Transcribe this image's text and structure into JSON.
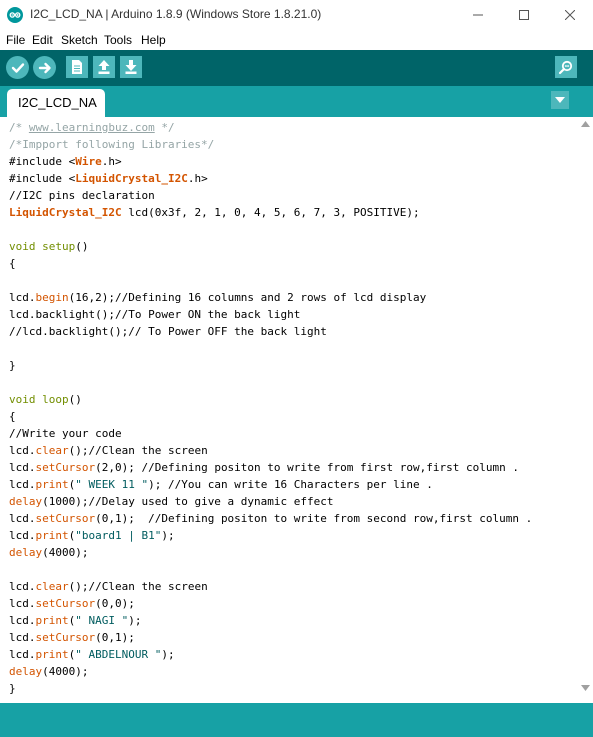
{
  "window": {
    "title": "I2C_LCD_NA | Arduino 1.8.9 (Windows Store 1.8.21.0)"
  },
  "menu": {
    "file": "File",
    "edit": "Edit",
    "sketch": "Sketch",
    "tools": "Tools",
    "help": "Help"
  },
  "toolbar": {
    "icons": [
      "verify-icon",
      "upload-icon",
      "new-icon",
      "open-icon",
      "save-icon",
      "serial-monitor-icon"
    ]
  },
  "tabs": [
    {
      "label": "I2C_LCD_NA",
      "active": true
    }
  ],
  "colors": {
    "toolbar_bg": "#006468",
    "tabstrip_bg": "#17a1a5",
    "button_bg": "#4db7bb",
    "comment": "#95a5a6",
    "keyword": "#728e00",
    "function": "#d35400",
    "string": "#005c5f"
  },
  "code": [
    [
      {
        "t": "/* ",
        "c": "com"
      },
      {
        "t": "www.learningbuz.com",
        "c": "url"
      },
      {
        "t": " */",
        "c": "com"
      }
    ],
    [
      {
        "t": "/*Impport following Libraries*/",
        "c": "com"
      }
    ],
    [
      {
        "t": "#include <",
        "c": "plain"
      },
      {
        "t": "Wire",
        "c": "cls"
      },
      {
        "t": ".h>",
        "c": "plain"
      }
    ],
    [
      {
        "t": "#include <",
        "c": "plain"
      },
      {
        "t": "LiquidCrystal_I2C",
        "c": "cls"
      },
      {
        "t": ".h>",
        "c": "plain"
      }
    ],
    [
      {
        "t": "//I2C pins declaration",
        "c": "plain"
      }
    ],
    [
      {
        "t": "LiquidCrystal_I2C",
        "c": "cls"
      },
      {
        "t": " lcd(0x3f, 2, 1, 0, 4, 5, 6, 7, 3, POSITIVE);",
        "c": "plain"
      }
    ],
    [],
    [
      {
        "t": "void",
        "c": "kw"
      },
      {
        "t": " ",
        "c": "plain"
      },
      {
        "t": "setup",
        "c": "kw"
      },
      {
        "t": "()",
        "c": "plain"
      }
    ],
    [
      {
        "t": "{",
        "c": "plain"
      }
    ],
    [],
    [
      {
        "t": "lcd.",
        "c": "plain"
      },
      {
        "t": "begin",
        "c": "fn"
      },
      {
        "t": "(16,2);//Defining 16 columns and 2 rows of lcd display",
        "c": "plain"
      }
    ],
    [
      {
        "t": "lcd.backlight();//To Power ON the back light",
        "c": "plain"
      }
    ],
    [
      {
        "t": "//lcd.backlight();// To Power OFF the back light",
        "c": "plain"
      }
    ],
    [],
    [
      {
        "t": "}",
        "c": "plain"
      }
    ],
    [],
    [
      {
        "t": "void",
        "c": "kw"
      },
      {
        "t": " ",
        "c": "plain"
      },
      {
        "t": "loop",
        "c": "kw"
      },
      {
        "t": "()",
        "c": "plain"
      }
    ],
    [
      {
        "t": "{",
        "c": "plain"
      }
    ],
    [
      {
        "t": "//Write your code",
        "c": "plain"
      }
    ],
    [
      {
        "t": "lcd.",
        "c": "plain"
      },
      {
        "t": "clear",
        "c": "fn"
      },
      {
        "t": "();//Clean the screen",
        "c": "plain"
      }
    ],
    [
      {
        "t": "lcd.",
        "c": "plain"
      },
      {
        "t": "setCursor",
        "c": "fn"
      },
      {
        "t": "(2,0); //Defining positon to write from first row,first column .",
        "c": "plain"
      }
    ],
    [
      {
        "t": "lcd.",
        "c": "plain"
      },
      {
        "t": "print",
        "c": "fn"
      },
      {
        "t": "(",
        "c": "plain"
      },
      {
        "t": "\" WEEK 11 \"",
        "c": "str"
      },
      {
        "t": "); //You can write 16 Characters per line .",
        "c": "plain"
      }
    ],
    [
      {
        "t": "delay",
        "c": "fn"
      },
      {
        "t": "(1000);//Delay used to give a dynamic effect",
        "c": "plain"
      }
    ],
    [
      {
        "t": "lcd.",
        "c": "plain"
      },
      {
        "t": "setCursor",
        "c": "fn"
      },
      {
        "t": "(0,1);  //Defining positon to write from second row,first column .",
        "c": "plain"
      }
    ],
    [
      {
        "t": "lcd.",
        "c": "plain"
      },
      {
        "t": "print",
        "c": "fn"
      },
      {
        "t": "(",
        "c": "plain"
      },
      {
        "t": "\"board1 | B1\"",
        "c": "str"
      },
      {
        "t": ");",
        "c": "plain"
      }
    ],
    [
      {
        "t": "delay",
        "c": "fn"
      },
      {
        "t": "(4000);",
        "c": "plain"
      }
    ],
    [],
    [
      {
        "t": "lcd.",
        "c": "plain"
      },
      {
        "t": "clear",
        "c": "fn"
      },
      {
        "t": "();//Clean the screen",
        "c": "plain"
      }
    ],
    [
      {
        "t": "lcd.",
        "c": "plain"
      },
      {
        "t": "setCursor",
        "c": "fn"
      },
      {
        "t": "(0,0);",
        "c": "plain"
      }
    ],
    [
      {
        "t": "lcd.",
        "c": "plain"
      },
      {
        "t": "print",
        "c": "fn"
      },
      {
        "t": "(",
        "c": "plain"
      },
      {
        "t": "\" NAGI \"",
        "c": "str"
      },
      {
        "t": ");",
        "c": "plain"
      }
    ],
    [
      {
        "t": "lcd.",
        "c": "plain"
      },
      {
        "t": "setCursor",
        "c": "fn"
      },
      {
        "t": "(0,1);",
        "c": "plain"
      }
    ],
    [
      {
        "t": "lcd.",
        "c": "plain"
      },
      {
        "t": "print",
        "c": "fn"
      },
      {
        "t": "(",
        "c": "plain"
      },
      {
        "t": "\" ABDELNOUR \"",
        "c": "str"
      },
      {
        "t": ");",
        "c": "plain"
      }
    ],
    [
      {
        "t": "delay",
        "c": "fn"
      },
      {
        "t": "(4000);",
        "c": "plain"
      }
    ],
    [
      {
        "t": "}",
        "c": "plain"
      }
    ]
  ]
}
